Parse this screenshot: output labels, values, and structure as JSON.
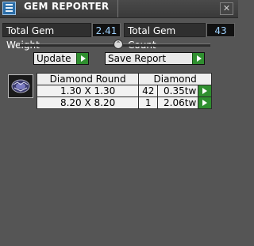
{
  "window": {
    "title": "GEM REPORTER",
    "close_glyph": "✕"
  },
  "stats": {
    "weight_label": "Total Gem Weight",
    "weight_value": "2.41",
    "count_label": "Total Gem Count",
    "count_value": "43"
  },
  "toolbar": {
    "collapse_glyph": "⌃",
    "update_label": "Update",
    "save_label": "Save Report"
  },
  "results": {
    "icon": "diamond-icon",
    "headers": [
      "Diamond Round",
      "Diamond"
    ],
    "rows": [
      {
        "size": "1.30 X 1.30",
        "count": "42",
        "weight": "0.35tw"
      },
      {
        "size": "8.20 X 8.20",
        "count": "1",
        "weight": "2.06tw"
      }
    ]
  },
  "colors": {
    "background": "#555555",
    "titlebar": "#3f3f3f",
    "accent_green": "#2f8f2f",
    "value_text": "#9fd2ff"
  }
}
